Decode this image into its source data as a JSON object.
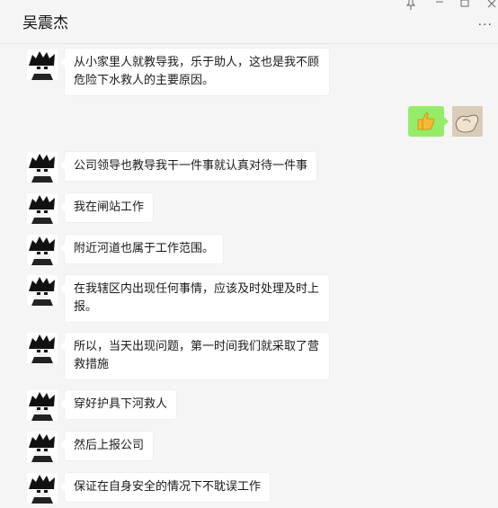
{
  "window": {
    "title": "吴震杰",
    "pin_icon": "pin-icon",
    "minimize_icon": "minimize-icon",
    "maximize_icon": "maximize-icon",
    "close_icon": "close-icon",
    "more_icon": "more-icon"
  },
  "messages": [
    {
      "sender": "other",
      "text": "从小家里人就教导我，乐于助人，这也是我不顾危险下水救人的主要原因。"
    },
    {
      "sender": "self",
      "content": "thumbs-up-emoji"
    },
    {
      "sender": "other",
      "text": "公司领导也教导我干一件事就认真对待一件事"
    },
    {
      "sender": "other",
      "text": "我在闸站工作"
    },
    {
      "sender": "other",
      "text": "附近河道也属于工作范围。"
    },
    {
      "sender": "other",
      "text": "在我辖区内出现任何事情，应该及时处理及时上报。"
    },
    {
      "sender": "other",
      "text": "所以，当天出现问题，第一时间我们就采取了营救措施"
    },
    {
      "sender": "other",
      "text": "穿好护具下河救人"
    },
    {
      "sender": "other",
      "text": "然后上报公司"
    },
    {
      "sender": "other",
      "text": "保证在自身安全的情况下不耽误工作"
    }
  ]
}
